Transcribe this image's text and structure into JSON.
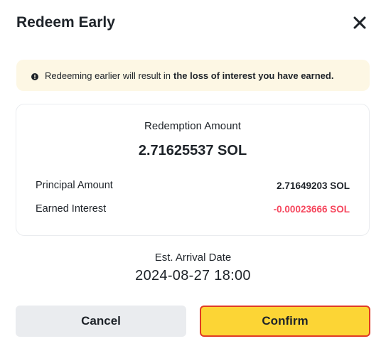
{
  "dialog": {
    "title": "Redeem Early",
    "close_icon": "close-icon"
  },
  "notice": {
    "icon": "warning-icon",
    "text": "Redeeming earlier will result in",
    "bold_text": "the loss of interest you have earned."
  },
  "summary": {
    "redemption_label": "Redemption Amount",
    "redemption_amount": "2.71625537 SOL",
    "principal_label": "Principal Amount",
    "principal_value": "2.71649203 SOL",
    "interest_label": "Earned Interest",
    "interest_value": "-0.00023666 SOL"
  },
  "arrival": {
    "label": "Est. Arrival Date",
    "date": "2024-08-27 18:00"
  },
  "buttons": {
    "cancel": "Cancel",
    "confirm": "Confirm"
  },
  "colors": {
    "accent": "#fcd535",
    "negative": "#f6465d",
    "notice_bg": "#fdf7e4",
    "highlight_border": "#e03b24"
  }
}
